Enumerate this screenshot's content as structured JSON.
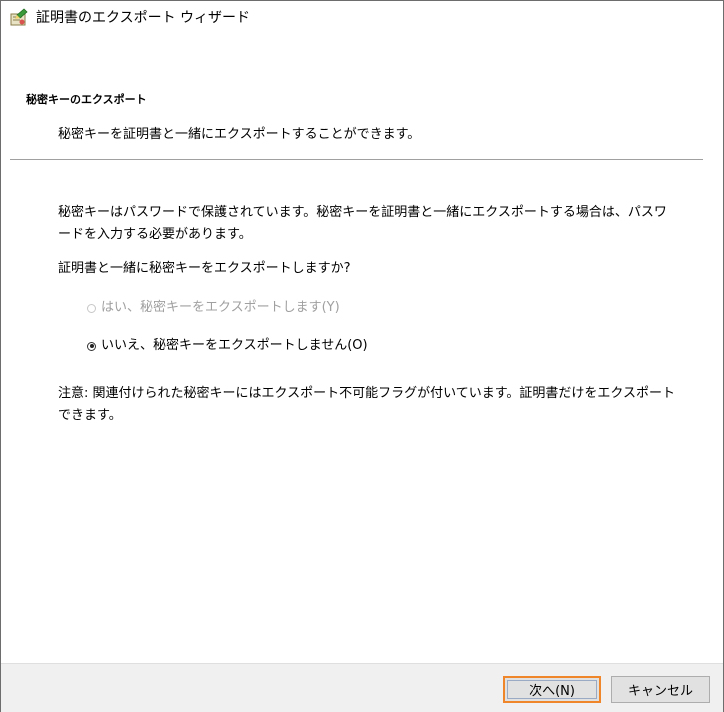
{
  "window": {
    "title": "証明書のエクスポート ウィザード",
    "icon": "certificate-wizard-icon"
  },
  "header": {
    "title": "秘密キーのエクスポート",
    "description": "秘密キーを証明書と一緒にエクスポートすることができます。"
  },
  "body": {
    "explanation": "秘密キーはパスワードで保護されています。秘密キーを証明書と一緒にエクスポートする場合は、パスワードを入力する必要があります。",
    "question": "証明書と一緒に秘密キーをエクスポートしますか?",
    "options": [
      {
        "label": "はい、秘密キーをエクスポートします(Y)",
        "selected": false,
        "enabled": false
      },
      {
        "label": "いいえ、秘密キーをエクスポートしません(O)",
        "selected": true,
        "enabled": true
      }
    ],
    "note": "注意: 関連付けられた秘密キーにはエクスポート不可能フラグが付いています。証明書だけをエクスポートできます。"
  },
  "footer": {
    "next_label": "次へ(N)",
    "cancel_label": "キャンセル"
  },
  "colors": {
    "focus_highlight": "#f0862a",
    "footer_background": "#f0f0f0",
    "disabled_text": "#a0a0a0"
  }
}
